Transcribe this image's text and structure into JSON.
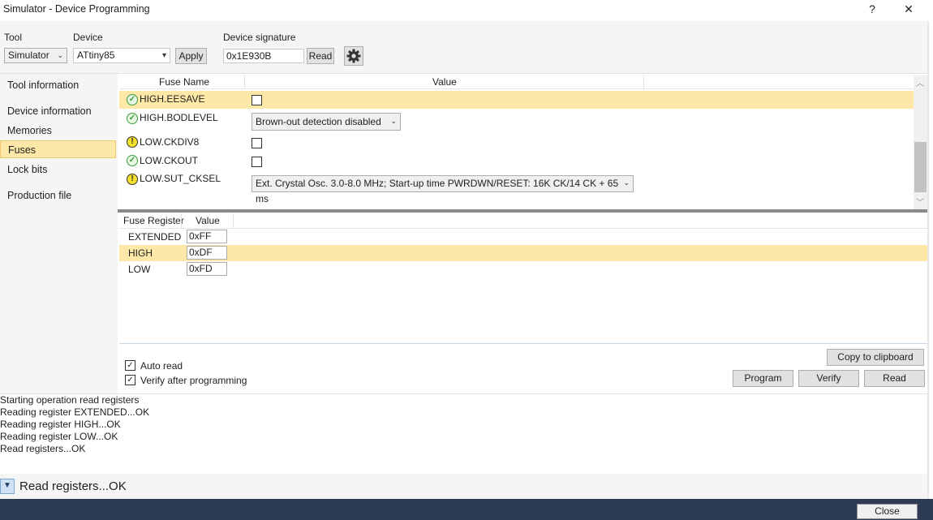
{
  "window": {
    "title": "Simulator - Device Programming",
    "help_label": "?",
    "close_glyph": "✕"
  },
  "toolbar": {
    "tool_label": "Tool",
    "tool_value": "Simulator",
    "device_label": "Device",
    "device_value": "ATtiny85",
    "apply_label": "Apply",
    "signature_label": "Device signature",
    "signature_value": "0x1E930B",
    "read_label": "Read"
  },
  "nav": {
    "items": [
      {
        "label": "Tool information"
      },
      {
        "label": "Device information"
      },
      {
        "label": "Memories"
      },
      {
        "label": "Fuses"
      },
      {
        "label": "Lock bits"
      },
      {
        "label": "Production file"
      }
    ],
    "selected": "Fuses"
  },
  "fuses": {
    "col_name": "Fuse Name",
    "col_value": "Value",
    "rows": [
      {
        "name": "HIGH.EESAVE",
        "status": "ok",
        "type": "checkbox",
        "checked": false
      },
      {
        "name": "HIGH.BODLEVEL",
        "status": "ok",
        "type": "select",
        "value": "Brown-out detection disabled"
      },
      {
        "name": "LOW.CKDIV8",
        "status": "warning",
        "type": "checkbox",
        "checked": false
      },
      {
        "name": "LOW.CKOUT",
        "status": "ok",
        "type": "checkbox",
        "checked": false
      },
      {
        "name": "LOW.SUT_CKSEL",
        "status": "warning",
        "type": "select",
        "value": "Ext. Crystal Osc. 3.0-8.0 MHz; Start-up time PWRDWN/RESET: 16K CK/14 CK + 65 ms"
      }
    ]
  },
  "registers": {
    "col_register": "Fuse Register",
    "col_value": "Value",
    "rows": [
      {
        "name": "EXTENDED",
        "value": "0xFF"
      },
      {
        "name": "HIGH",
        "value": "0xDF"
      },
      {
        "name": "LOW",
        "value": "0xFD"
      }
    ]
  },
  "options": {
    "auto_read_label": "Auto read",
    "auto_read_checked": true,
    "verify_label": "Verify after programming",
    "verify_checked": true
  },
  "actions": {
    "copy_label": "Copy to clipboard",
    "program_label": "Program",
    "verify_label": "Verify",
    "read_label": "Read"
  },
  "log": {
    "lines": [
      "Starting operation read registers",
      "Reading register EXTENDED...OK",
      "Reading register HIGH...OK",
      "Reading register LOW...OK",
      "Read registers...OK"
    ]
  },
  "status": {
    "text": "Read registers...OK"
  },
  "footer": {
    "close_label": "Close"
  },
  "colors": {
    "selection": "#fde8a8",
    "footer_bg": "#2d3b55",
    "ok_green": "#3a9d3a",
    "warn_yellow": "#f5e02a"
  }
}
